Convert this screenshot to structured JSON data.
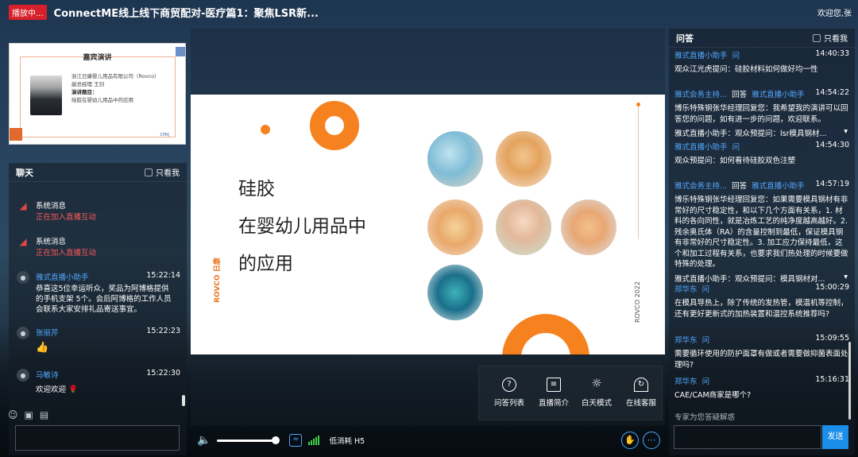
{
  "header": {
    "live_badge": "播放中...",
    "title": "ConnectME线上线下商贸配对-医疗篇1：聚焦LSR新...",
    "welcome": "欢迎您,张"
  },
  "guest_card": {
    "heading": "嘉宾演讲",
    "company": "浙江日康婴儿用品有限公司（Rovco）",
    "position": "副总经理 王剑",
    "topic_label": "演讲题目：",
    "topic": "硅胶在婴幼儿用品中的应用"
  },
  "chat": {
    "title": "聊天",
    "only_me": "只看我",
    "messages": [
      {
        "type": "system",
        "name": "系统消息",
        "text": "正在加入直播互动"
      },
      {
        "type": "system",
        "name": "系统消息",
        "text": "正在加入直播互动"
      },
      {
        "type": "user",
        "name": "雅式直播小助手",
        "time": "15:22:14",
        "text": "恭喜这5位幸运听众，奖品为阿博格提供的手机支架 5个。会后阿博格的工作人员会联系大家安排礼品寄送事宜。"
      },
      {
        "type": "user",
        "name": "张丽芹",
        "time": "15:22:23",
        "text": "👍"
      },
      {
        "type": "user",
        "name": "马敏诗",
        "time": "15:22:30",
        "text": "欢迎欢迎 🌹"
      }
    ]
  },
  "slide": {
    "line1": "硅胶",
    "line2": "在婴幼儿用品中",
    "line3": "的应用",
    "brand_vertical": "ROVCO 日康",
    "year_vertical": "ROVCO 2022"
  },
  "tools": [
    {
      "label": "问答列表",
      "icon": "question-icon"
    },
    {
      "label": "直播简介",
      "icon": "document-icon"
    },
    {
      "label": "白天模式",
      "icon": "sun-icon"
    },
    {
      "label": "在线客服",
      "icon": "headset-icon"
    }
  ],
  "controls": {
    "quality": "低消耗 H5"
  },
  "qa": {
    "title": "问答",
    "only_me": "只看我",
    "items": [
      {
        "asker": "雅式直播小助手",
        "tag": "问",
        "time": "14:40:33",
        "text": "观众江光虎提问：硅胶材料如何做好均一性"
      },
      {
        "asker": "雅式会务主持...",
        "tag": "回答",
        "to": "雅式直播小助手",
        "time": "14:54:22",
        "text": "博乐特殊钢张华经理回复您：我希望我的演讲可以回答您的问题，如有进一步的问题，欢迎联系。",
        "sub": "雅式直播小助手：观众预提问：lsr模具钢材..."
      },
      {
        "asker": "雅式直播小助手",
        "tag": "问",
        "time": "14:54:30",
        "text": "观众预提问：如何看待硅胶双色注塑"
      },
      {
        "asker": "雅式会务主持...",
        "tag": "回答",
        "to": "雅式直播小助手",
        "time": "14:57:19",
        "text": "博乐特殊钢张华经理回复您：如果需要模具钢材有非常好的尺寸稳定性，和以下几个方面有关系，1. 材料的各向同性，就是冶炼工艺的纯净度越高越好。2. 残余奥氏体（RA）的含量控制到最低，保证模具钢有非常好的尺寸稳定性。3. 加工应力保持最低，这个和加工过程有关系，也要求我们热处理的时候要做特殊的处理。",
        "sub": "雅式直播小助手：观众预提问：模具钢材对..."
      },
      {
        "asker": "郑华东",
        "tag": "问",
        "time": "15:00:29",
        "text": "在模具导热上，除了传统的发热管，模温机等控制，还有更好更新式的加热装置和温控系统推荐吗?"
      },
      {
        "asker": "郑华东",
        "tag": "问",
        "time": "15:09:55",
        "text": "需要循环使用的防护面罩有做或者需要做抑菌表面处理吗?"
      },
      {
        "asker": "郑华东",
        "tag": "问",
        "time": "15:16:31",
        "text": "CAE/CAM商家是哪个?"
      }
    ],
    "input_prompt": "专家为您答疑解惑",
    "send": "发送"
  },
  "colors": {
    "accent": "#1a8ee8",
    "live": "#d8202a",
    "slide_orange": "#f5821f",
    "name_blue": "#52a8ff"
  }
}
